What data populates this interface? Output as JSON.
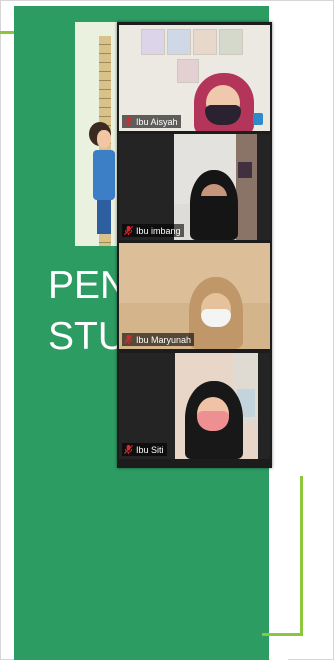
{
  "slide": {
    "title": "PEN\nSTU",
    "background_color": "#2d9c63",
    "accent_line_color": "#8cc63f"
  },
  "participants": [
    {
      "name": "Ibu Aisyah",
      "mic_icon": "mic-muted-icon"
    },
    {
      "name": "Ibu imbang",
      "mic_icon": "mic-muted-icon"
    },
    {
      "name": "Ibu Maryunah",
      "mic_icon": "mic-muted-icon"
    },
    {
      "name": "Ibu Siti",
      "mic_icon": "mic-muted-icon"
    }
  ],
  "colors": {
    "mic_muted": "#e0262c",
    "gallery_background": "#1c1c1c"
  }
}
